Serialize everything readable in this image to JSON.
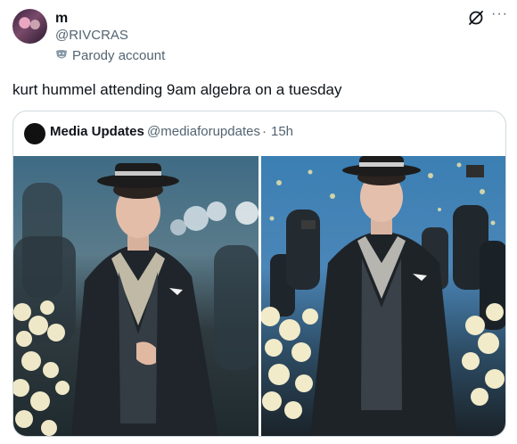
{
  "author": {
    "display_name": "m",
    "handle": "@RIVCRAS",
    "badge_text": "Parody account",
    "badge_icon": "parody-mask-icon"
  },
  "tweet": {
    "text": "kurt hummel attending 9am algebra on a tuesday"
  },
  "quoted_tweet": {
    "display_name": "Media Updates",
    "handle": "@mediaforupdates",
    "separator": "·",
    "time": "15h"
  },
  "icons": {
    "grok": "grok-icon",
    "more": "more-options-icon"
  },
  "colors": {
    "text_primary": "#0f1419",
    "text_secondary": "#536471",
    "border": "#cfd9de"
  }
}
